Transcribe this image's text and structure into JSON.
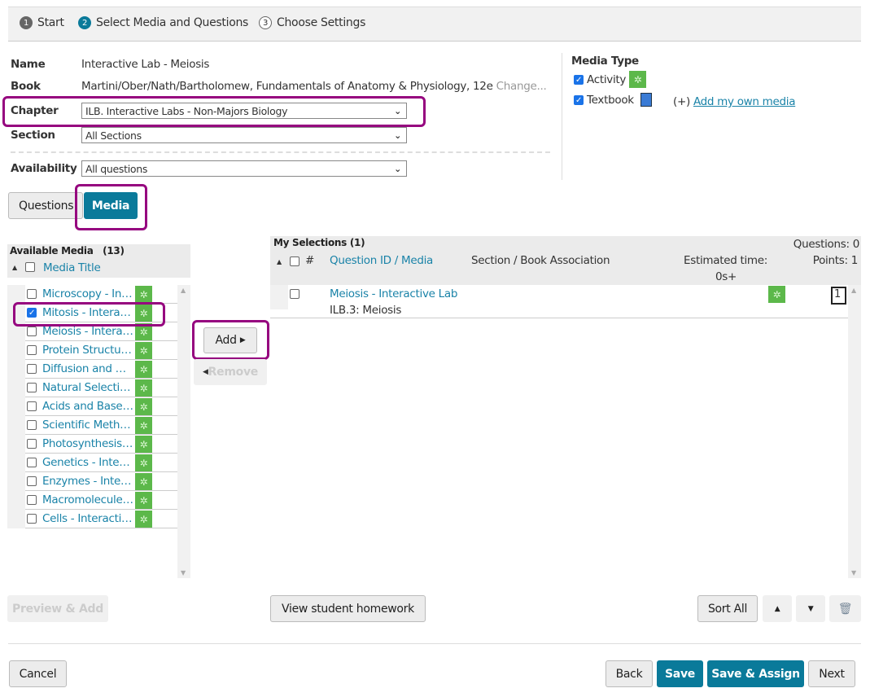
{
  "steps": [
    {
      "num": "1",
      "label": "Start"
    },
    {
      "num": "2",
      "label": "Select Media and Questions"
    },
    {
      "num": "3",
      "label": "Choose Settings"
    }
  ],
  "form": {
    "name_label": "Name",
    "name_value": "Interactive Lab - Meiosis",
    "book_label": "Book",
    "book_value": "Martini/Ober/Nath/Bartholomew, Fundamentals of Anatomy & Physiology, 12e",
    "change_link": "Change...",
    "chapter_label": "Chapter",
    "chapter_value": "ILB. Interactive Labs - Non-Majors Biology",
    "section_label": "Section",
    "section_value": "All Sections",
    "availability_label": "Availability",
    "availability_value": "All questions"
  },
  "media_type": {
    "title": "Media Type",
    "activity": "Activity",
    "textbook": "Textbook",
    "add_prefix": "(+)",
    "add_link": "Add my own media"
  },
  "tabs": {
    "questions": "Questions",
    "media": "Media"
  },
  "available": {
    "title": "Available Media",
    "count": "(13)",
    "column": "Media Title",
    "items": [
      "Microscopy - Interactive Lab",
      "Mitosis - Interactive Lab",
      "Meiosis - Interactive Lab",
      "Protein Structure - Interactive Lab",
      "Diffusion and Osmosis - Interactive Lab",
      "Natural Selection - Interactive Lab",
      "Acids and Bases - Interactive Lab",
      "Scientific Method - Interactive Lab",
      "Photosynthesis - Interactive Lab",
      "Genetics - Interactive Lab",
      "Enzymes - Interactive Lab",
      "Macromolecules - Interactive Lab",
      "Cells - Interactive Lab"
    ],
    "checked_index": 1
  },
  "actions": {
    "add": "Add",
    "remove": "Remove"
  },
  "selections": {
    "title": "My Selections (1)",
    "questions": "Questions: 0",
    "col_num": "#",
    "col_id": "Question ID / Media",
    "col_section": "Section / Book Association",
    "col_time": "Estimated time:",
    "time_value": "0s+",
    "points": "Points: 1",
    "rows": [
      {
        "title": "Meiosis - Interactive Lab",
        "section": "ILB.3: Meiosis",
        "points": "1"
      }
    ]
  },
  "bottom": {
    "preview": "Preview & Add",
    "view_homework": "View student homework",
    "sort_all": "Sort All",
    "cancel": "Cancel",
    "back": "Back",
    "save": "Save",
    "save_assign": "Save & Assign",
    "next": "Next"
  },
  "colors": {
    "accent": "#0a7a9a",
    "highlight": "#96067f",
    "activity_icon": "#5cb84a"
  }
}
